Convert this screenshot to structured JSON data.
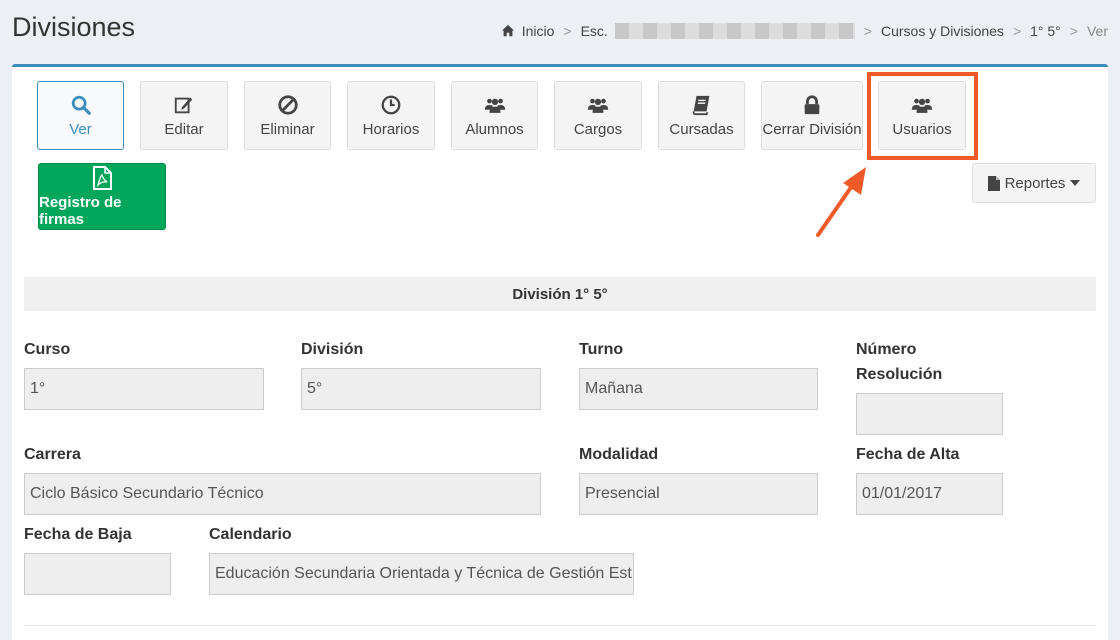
{
  "header": {
    "title": "Divisiones",
    "breadcrumb": {
      "home": "Inicio",
      "school_prefix": "Esc.",
      "courses": "Cursos y Divisiones",
      "division": "1° 5°",
      "current": "Ver",
      "separator": ">"
    }
  },
  "toolbar": {
    "buttons": [
      {
        "label": "Ver",
        "icon": "search-icon"
      },
      {
        "label": "Editar",
        "icon": "edit-icon"
      },
      {
        "label": "Eliminar",
        "icon": "ban-icon"
      },
      {
        "label": "Horarios",
        "icon": "clock-icon"
      },
      {
        "label": "Alumnos",
        "icon": "users-icon"
      },
      {
        "label": "Cargos",
        "icon": "users-icon"
      },
      {
        "label": "Cursadas",
        "icon": "book-icon"
      },
      {
        "label": "Cerrar División",
        "icon": "lock-icon"
      },
      {
        "label": "Usuarios",
        "icon": "users-icon"
      }
    ],
    "signatures_button": "Registro de firmas",
    "reports_button": "Reportes"
  },
  "colors": {
    "primary": "#3c8dbc",
    "success": "#00a65a",
    "highlight": "#f05a28"
  },
  "section": {
    "title": "División 1° 5°"
  },
  "form": {
    "curso": {
      "label": "Curso",
      "value": "1°"
    },
    "division": {
      "label": "División",
      "value": "5°"
    },
    "turno": {
      "label": "Turno",
      "value": "Mañana"
    },
    "numero_resolucion": {
      "label_line1": "Número",
      "label_line2": "Resolución",
      "value": ""
    },
    "carrera": {
      "label": "Carrera",
      "value": "Ciclo Básico Secundario Técnico"
    },
    "modalidad": {
      "label": "Modalidad",
      "value": "Presencial"
    },
    "fecha_alta": {
      "label": "Fecha de Alta",
      "value": "01/01/2017"
    },
    "fecha_baja": {
      "label": "Fecha de Baja",
      "value": ""
    },
    "calendario": {
      "label": "Calendario",
      "value": "Educación Secundaria Orientada y Técnica de Gestión Est"
    }
  }
}
